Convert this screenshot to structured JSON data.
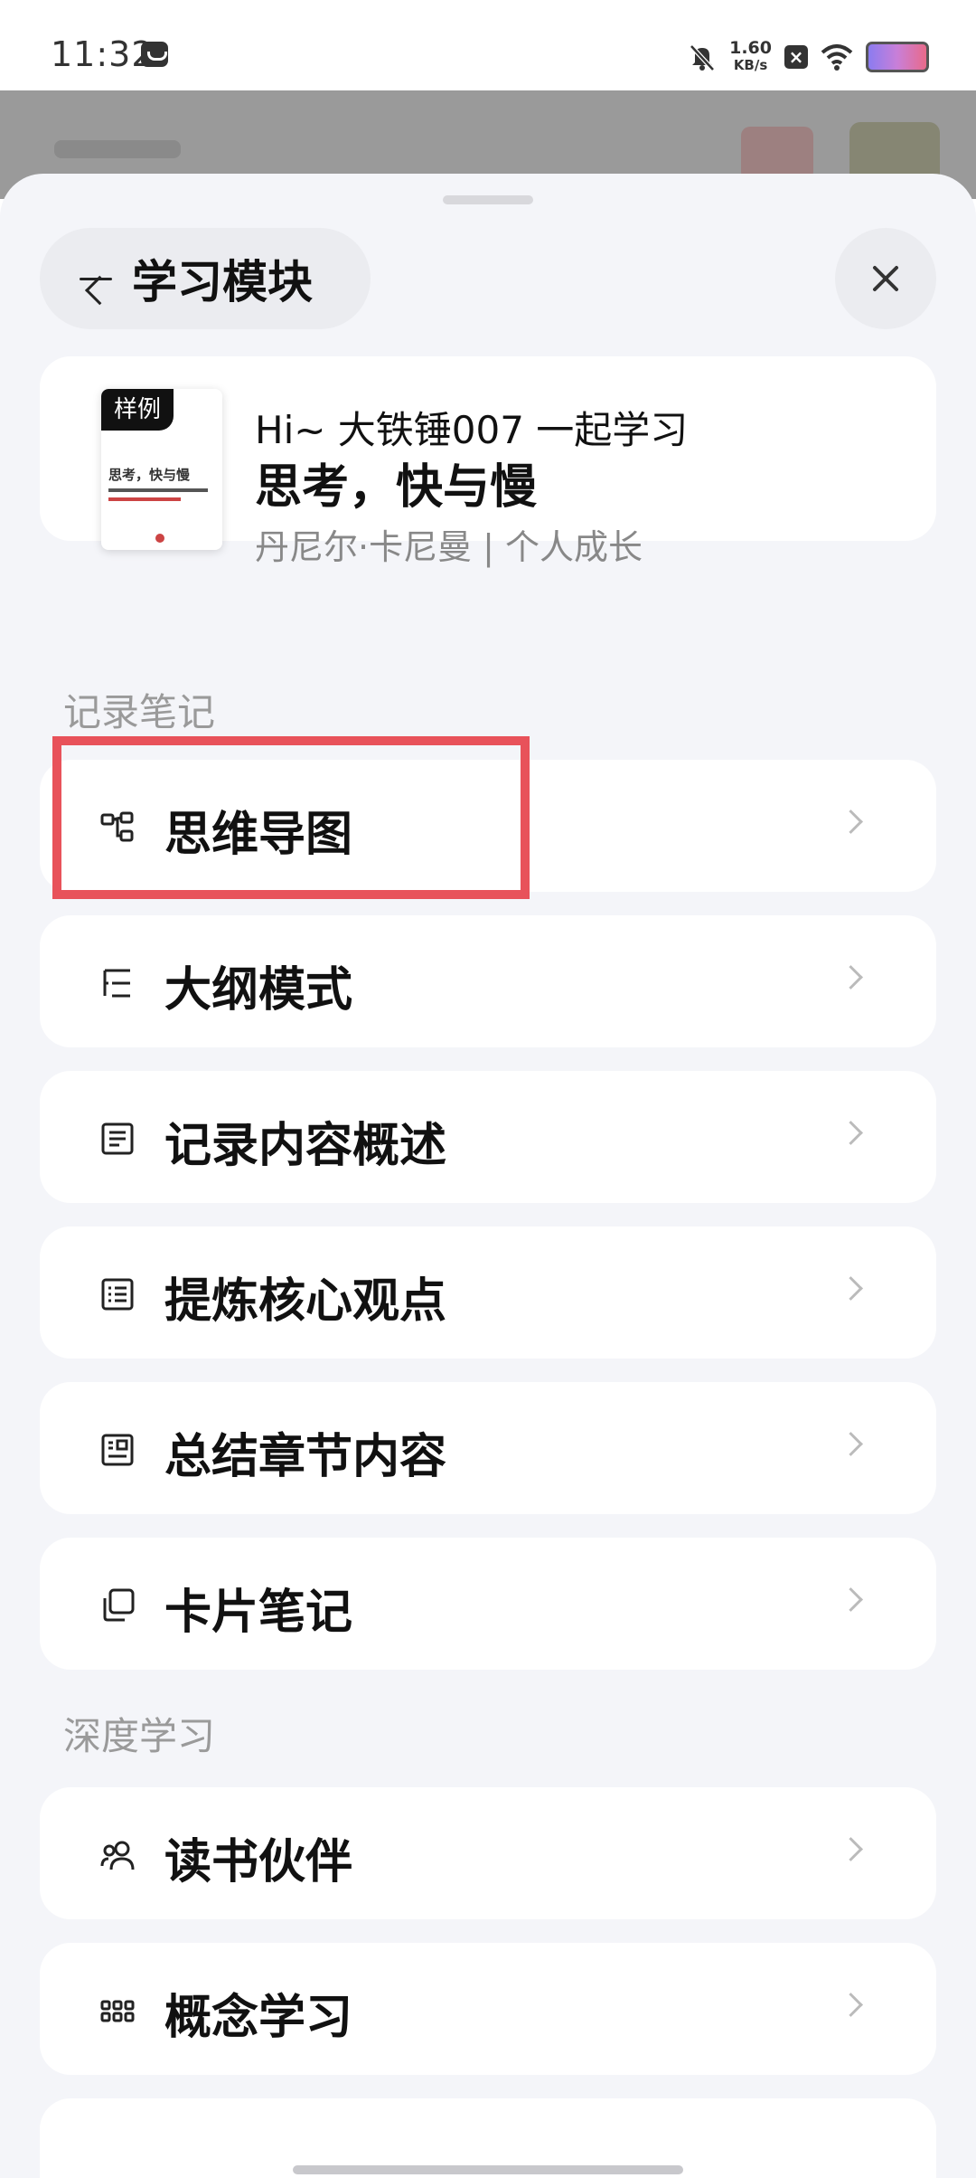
{
  "status": {
    "time": "11:32",
    "speed_value": "1.60",
    "speed_unit": "KB/s"
  },
  "header": {
    "title": "学习模块",
    "back_icon": "arrow-left-icon",
    "close_icon": "close-icon"
  },
  "book": {
    "cover_tag": "样例",
    "cover_title": "思考，快与慢",
    "greeting": "Hi~ 大铁锤007 一起学习",
    "title": "思考，快与慢",
    "meta": "丹尼尔·卡尼曼 | 个人成长"
  },
  "sections": {
    "notes": "记录笔记",
    "deep": "深度学习"
  },
  "notes_items": [
    {
      "label": "思维导图",
      "icon": "mind-map-icon"
    },
    {
      "label": "大纲模式",
      "icon": "outline-icon"
    },
    {
      "label": "记录内容概述",
      "icon": "summary-doc-icon"
    },
    {
      "label": "提炼核心观点",
      "icon": "key-points-icon"
    },
    {
      "label": "总结章节内容",
      "icon": "chapter-summary-icon"
    },
    {
      "label": "卡片笔记",
      "icon": "card-notes-icon"
    }
  ],
  "deep_items": [
    {
      "label": "读书伙伴",
      "icon": "reading-partner-icon"
    },
    {
      "label": "概念学习",
      "icon": "concept-grid-icon"
    }
  ],
  "colors": {
    "highlight": "#e8525a",
    "sheet_bg": "#f4f5f9"
  }
}
